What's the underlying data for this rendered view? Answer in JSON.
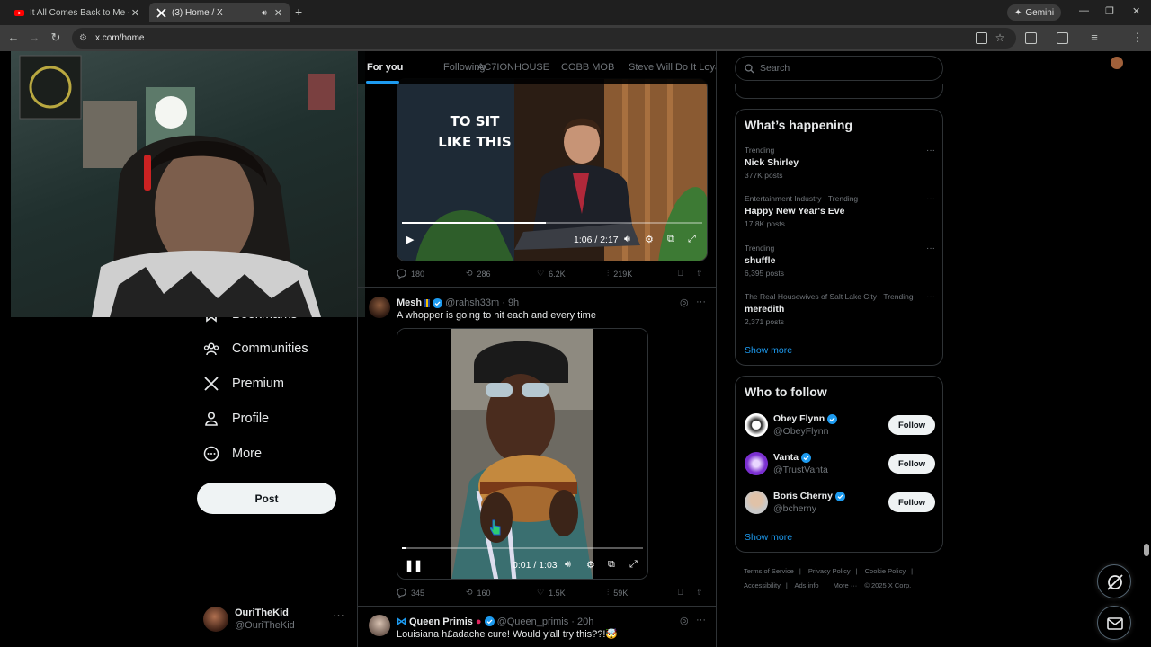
{
  "browser": {
    "tabs": [
      {
        "title": "It All Comes Back to Me - Baby"
      },
      {
        "title": "(3) Home / X"
      }
    ],
    "gemini_label": "Gemini",
    "url": "x.com/home"
  },
  "nav": {
    "items": [
      {
        "label": "Bookmarks",
        "icon": "bookmark-icon"
      },
      {
        "label": "Communities",
        "icon": "communities-icon"
      },
      {
        "label": "Premium",
        "icon": "x-logo-icon"
      },
      {
        "label": "Profile",
        "icon": "profile-icon"
      },
      {
        "label": "More",
        "icon": "more-circle-icon"
      }
    ],
    "post_label": "Post",
    "account": {
      "name": "OuriTheKid",
      "handle": "@OuriTheKid"
    }
  },
  "feed": {
    "tabs": [
      "For you",
      "Following",
      "AC7IONHOUSE",
      "COBB MOB",
      "Steve Will Do It Loyal"
    ],
    "tweet1": {
      "video_caption": "TO SIT\nLIKE THIS",
      "time": "1:06 / 2:17",
      "progress": 0.48,
      "stats": {
        "replies": "180",
        "reposts": "286",
        "likes": "6.2K",
        "views": "219K"
      }
    },
    "tweet2": {
      "name": "Mesh",
      "handle": "@rahsh33m",
      "age": "· 9h",
      "text": "A whopper is going to hit each and every time",
      "time": "0:01 / 1:03",
      "progress": 0.02,
      "stats": {
        "replies": "345",
        "reposts": "160",
        "likes": "1.5K",
        "views": "59K"
      }
    },
    "tweet3": {
      "name": "Queen Primis",
      "handle": "@Queen_primis",
      "age": "· 20h",
      "text": "Louisiana h£adache cure! Would y'all try this??!🤯"
    }
  },
  "right": {
    "search_placeholder": "Search",
    "happening_title": "What’s happening",
    "trends": [
      {
        "context": "Trending",
        "title": "Nick Shirley",
        "count": "377K posts"
      },
      {
        "context": "Entertainment Industry · Trending",
        "title": "Happy New Year's Eve",
        "count": "17.8K posts"
      },
      {
        "context": "Trending",
        "title": "shuffle",
        "count": "6,395 posts"
      },
      {
        "context": "The Real Housewives of Salt Lake City · Trending",
        "title": "meredith",
        "count": "2,371 posts"
      }
    ],
    "show_more": "Show more",
    "wtf_title": "Who to follow",
    "who_to_follow": [
      {
        "name": "Obey Flynn",
        "handle": "@ObeyFlynn",
        "button": "Follow"
      },
      {
        "name": "Vanta",
        "handle": "@TrustVanta",
        "button": "Follow"
      },
      {
        "name": "Boris Cherny",
        "handle": "@bcherny",
        "button": "Follow"
      }
    ],
    "footer": [
      "Terms of Service",
      "|",
      "Privacy Policy",
      "|",
      "Cookie Policy",
      "|",
      "Accessibility",
      "|",
      "Ads info",
      "|",
      "More ···",
      "© 2025 X Corp."
    ]
  },
  "colors": {
    "accent": "#1d9bf0",
    "bg": "#000000",
    "text": "#e7e9ea",
    "muted": "#71767b"
  }
}
